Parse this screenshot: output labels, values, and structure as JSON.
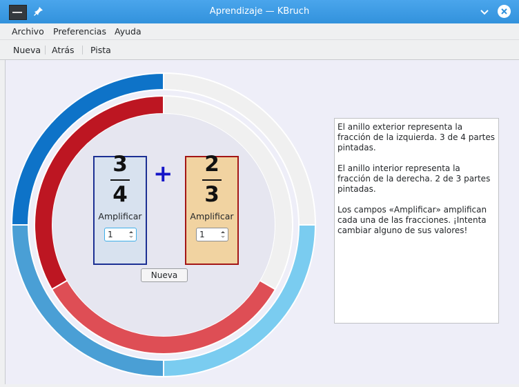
{
  "window": {
    "title": "Aprendizaje — KBruch"
  },
  "menubar": {
    "items": [
      "Archivo",
      "Preferencias",
      "Ayuda"
    ]
  },
  "toolbar": {
    "items": [
      "Nueva",
      "Atrás",
      "Pista"
    ]
  },
  "exercise": {
    "operator": "+",
    "left_fraction": {
      "numerator": "3",
      "denominator": "4",
      "amplify_label": "Amplificar",
      "amplify_value": "1"
    },
    "right_fraction": {
      "numerator": "2",
      "denominator": "3",
      "amplify_label": "Amplificar",
      "amplify_value": "1"
    },
    "new_button_label": "Nueva"
  },
  "rings": {
    "outer": {
      "filled_parts": 3,
      "total_parts": 4
    },
    "inner": {
      "filled_parts": 2,
      "total_parts": 3
    }
  },
  "info_panel": {
    "paragraphs": [
      "El anillo exterior representa la fracción de la izquierda. 3 de 4 partes pintadas.",
      "El anillo interior representa la fracción de la derecha. 2 de 3 partes pintadas.",
      "Los campos «Amplificar» amplifican cada una de las fracciones. ¡Intenta cambiar alguno de sus valores!"
    ]
  },
  "colors": {
    "titlebar": "#3d9ee5",
    "outer_ring_dark_blue": "#0e73c8",
    "outer_ring_mid_blue": "#4a9fd5",
    "outer_ring_light_blue": "#7accf0",
    "inner_ring_dark_red": "#bd1622",
    "inner_ring_light_red": "#de4e55",
    "empty_segment": "#f0f0f0",
    "left_box_bg": "#d8e2ef",
    "right_box_bg": "#f1d3a1"
  }
}
